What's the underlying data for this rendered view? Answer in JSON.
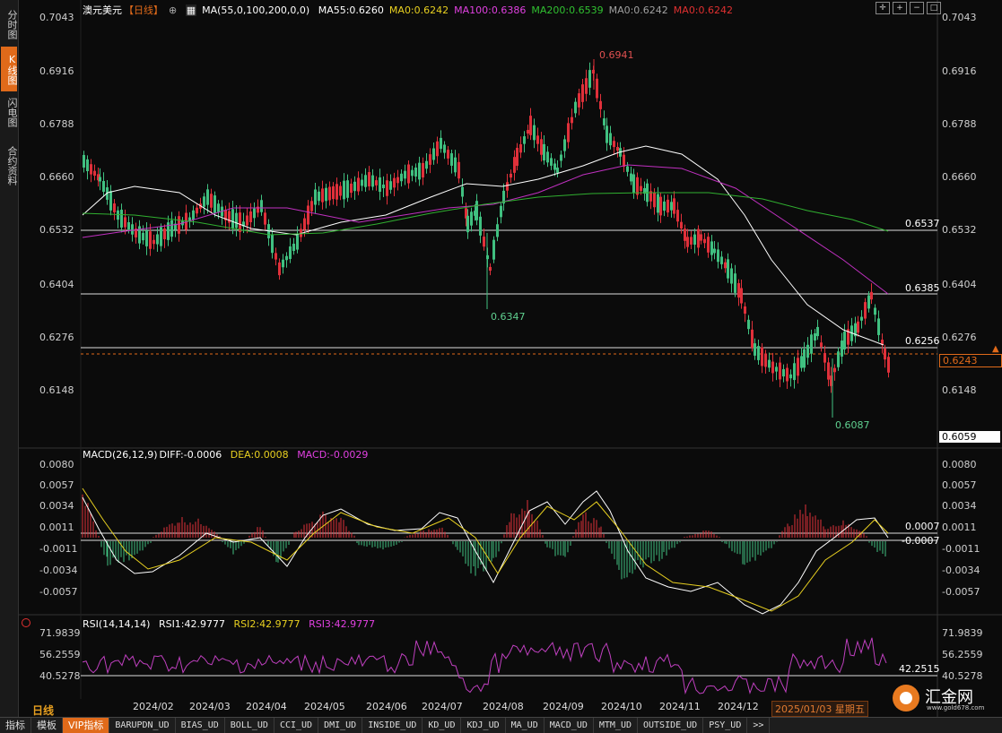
{
  "left_rail": {
    "tabs": [
      {
        "label": "分时图",
        "active": false
      },
      {
        "label": "K线图",
        "active": true
      },
      {
        "label": "闪电图",
        "active": false
      },
      {
        "label": "合约资料",
        "active": false
      }
    ]
  },
  "header": {
    "symbol": "澳元美元",
    "period": "【日线】",
    "ma_title": "MA(55,0,100,200,0,0)",
    "ma_items": [
      {
        "text": "MA55:0.6260",
        "color": "#ffffff"
      },
      {
        "text": "MA0:0.6242",
        "color": "#e8d020"
      },
      {
        "text": "MA100:0.6386",
        "color": "#e040e0"
      },
      {
        "text": "MA200:0.6539",
        "color": "#30c030"
      },
      {
        "text": "MA0:0.6242",
        "color": "#a0a0a0"
      },
      {
        "text": "MA0:0.6242",
        "color": "#e03030"
      }
    ]
  },
  "price_axis": [
    "0.7043",
    "0.6916",
    "0.6788",
    "0.6660",
    "0.6532",
    "0.6404",
    "0.6276",
    "0.6148"
  ],
  "price_tags": {
    "current": "0.6243",
    "low_bound": "0.6059"
  },
  "annotations": {
    "high": "0.6941",
    "mid_low": "0.6347",
    "low": "0.6087",
    "line1": "0.6537",
    "line2": "0.6385",
    "line3": "0.6256"
  },
  "macd": {
    "title": "MACD(26,12,9)",
    "diff": "DIFF:-0.0006",
    "dea": "DEA:0.0008",
    "macd": "MACD:-0.0029",
    "axis": [
      "0.0080",
      "0.0057",
      "0.0034",
      "0.0011",
      "-0.0011",
      "-0.0034",
      "-0.0057"
    ],
    "line_label_1": "0.0007",
    "line_label_2": "-0.0007"
  },
  "rsi": {
    "title": "RSI(14,14,14)",
    "rsi1": "RSI1:42.9777",
    "rsi2": "RSI2:42.9777",
    "rsi3": "RSI3:42.9777",
    "axis": [
      "71.9839",
      "56.2559",
      "40.5278"
    ],
    "line_label": "42.2515"
  },
  "x_axis": [
    "2024/02",
    "2024/03",
    "2024/04",
    "2024/05",
    "2024/06",
    "2024/07",
    "2024/08",
    "2024/09",
    "2024/10",
    "2024/11",
    "2024/12"
  ],
  "timeframe": "日线",
  "cursor_date": "2025/01/03 星期五",
  "logo": {
    "text": "汇金网",
    "sub": "www.gold678.com"
  },
  "bottom_tabs": [
    {
      "label": "指标",
      "cn": true,
      "active": false
    },
    {
      "label": "模板",
      "cn": true,
      "active": false
    },
    {
      "label": "VIP指标",
      "cn": true,
      "active": true
    },
    {
      "label": "BARUPDN_UD",
      "cn": false,
      "active": false
    },
    {
      "label": "BIAS_UD",
      "cn": false,
      "active": false
    },
    {
      "label": "BOLL_UD",
      "cn": false,
      "active": false
    },
    {
      "label": "CCI_UD",
      "cn": false,
      "active": false
    },
    {
      "label": "DMI_UD",
      "cn": false,
      "active": false
    },
    {
      "label": "INSIDE_UD",
      "cn": false,
      "active": false
    },
    {
      "label": "KD_UD",
      "cn": false,
      "active": false
    },
    {
      "label": "KDJ_UD",
      "cn": false,
      "active": false
    },
    {
      "label": "MA_UD",
      "cn": false,
      "active": false
    },
    {
      "label": "MACD_UD",
      "cn": false,
      "active": false
    },
    {
      "label": "MTM_UD",
      "cn": false,
      "active": false
    },
    {
      "label": "OUTSIDE_UD",
      "cn": false,
      "active": false
    },
    {
      "label": "PSY_UD",
      "cn": false,
      "active": false
    },
    {
      "label": ">>",
      "cn": false,
      "active": false
    }
  ],
  "colors": {
    "up": "#e0303a",
    "down": "#40c080",
    "ma55": "#ffffff",
    "ma100": "#c030c0",
    "ma200": "#30b030",
    "rsi": "#c040c0",
    "accent": "#e06a1a"
  }
}
